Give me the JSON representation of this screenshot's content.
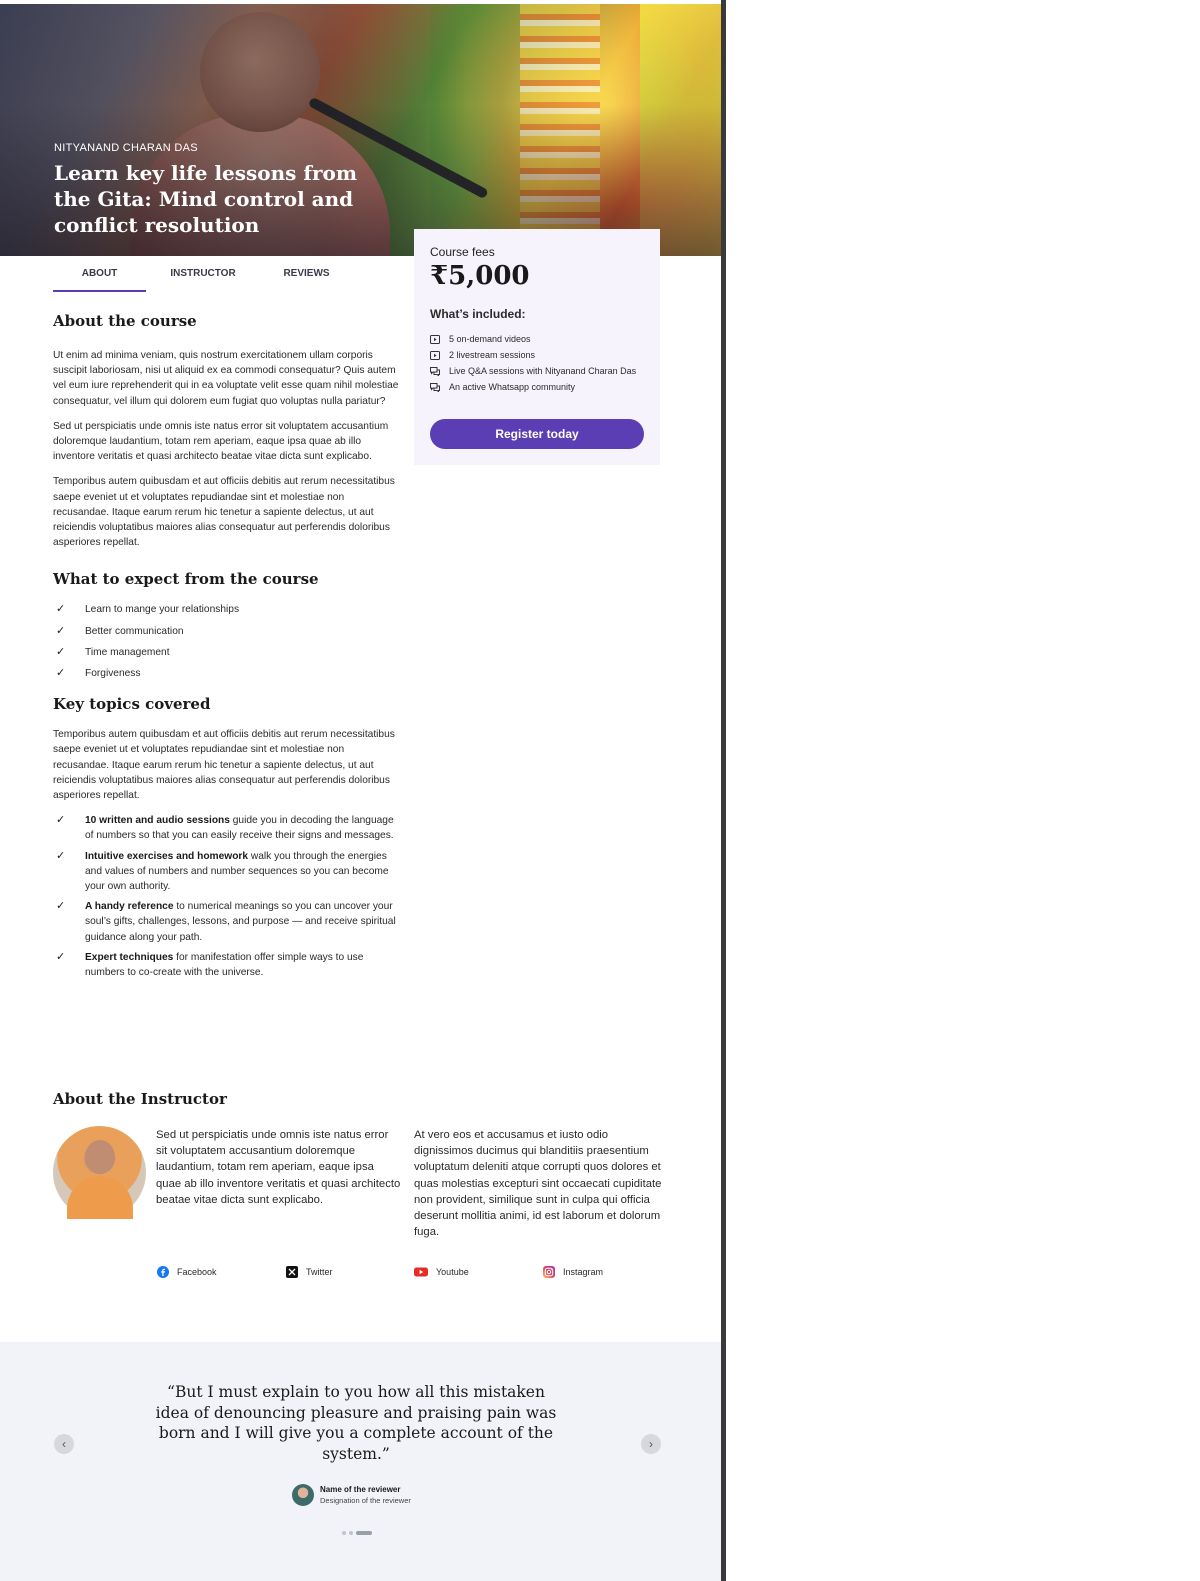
{
  "hero": {
    "eyebrow": "NITYANAND CHARAN DAS",
    "title": "Learn key life lessons from the Gita: Mind control and conflict resolution"
  },
  "tabs": [
    {
      "label": "ABOUT",
      "active": true
    },
    {
      "label": "INSTRUCTOR",
      "active": false
    },
    {
      "label": "REVIEWS",
      "active": false
    }
  ],
  "fees": {
    "label": "Course fees",
    "price": "₹5,000",
    "included_title": "What’s included:",
    "items": [
      {
        "icon": "play-video-icon",
        "text": "5 on-demand videos"
      },
      {
        "icon": "play-video-icon",
        "text": "2 livestream sessions"
      },
      {
        "icon": "chat-icon",
        "text": "Live Q&A sessions with Nityanand Charan Das"
      },
      {
        "icon": "chat-icon",
        "text": "An active Whatsapp community"
      }
    ],
    "register_label": "Register today"
  },
  "about": {
    "title": "About the course",
    "paragraphs": [
      "Ut enim ad minima veniam, quis nostrum exercitationem ullam corporis suscipit laboriosam, nisi ut aliquid ex ea commodi consequatur? Quis autem vel eum iure reprehenderit qui in ea voluptate velit esse quam nihil molestiae consequatur, vel illum qui dolorem eum fugiat quo voluptas nulla pariatur?",
      "Sed ut perspiciatis unde omnis iste natus error sit voluptatem accusantium doloremque laudantium, totam rem aperiam, eaque ipsa quae ab illo inventore veritatis et quasi architecto beatae vitae dicta sunt explicabo.",
      "Temporibus autem quibusdam et aut officiis debitis aut rerum necessitatibus saepe eveniet ut et voluptates repudiandae sint et molestiae non recusandae. Itaque earum rerum hic tenetur a sapiente delectus, ut aut reiciendis voluptatibus maiores alias consequatur aut perferendis doloribus asperiores repellat."
    ]
  },
  "expect": {
    "title": "What to expect from the course",
    "items": [
      "Learn to mange your relationships",
      "Better communication",
      "Time management",
      "Forgiveness"
    ]
  },
  "topics": {
    "title": "Key topics covered",
    "intro": "Temporibus autem quibusdam et aut officiis debitis aut rerum necessitatibus saepe eveniet ut et voluptates repudiandae sint et molestiae non recusandae. Itaque earum rerum hic tenetur a sapiente delectus, ut aut reiciendis voluptatibus maiores alias consequatur aut perferendis doloribus asperiores repellat.",
    "items": [
      {
        "bold": "10 written and audio sessions",
        "rest": " guide you in decoding the language of numbers so that you can easily receive their signs and messages."
      },
      {
        "bold": "Intuitive exercises and homework",
        "rest": " walk you through the energies and values of numbers and number sequences so you can become your own authority."
      },
      {
        "bold": "A handy reference",
        "rest": " to numerical meanings so you can uncover your soul’s gifts, challenges, lessons, and purpose — and receive spiritual guidance along your path."
      },
      {
        "bold": "Expert techniques",
        "rest": " for manifestation offer simple ways to use numbers to co-create with the universe."
      }
    ]
  },
  "instructor": {
    "title": "About the Instructor",
    "col1": "Sed ut perspiciatis unde omnis iste natus error sit voluptatem accusantium doloremque laudantium, totam rem aperiam, eaque ipsa quae ab illo inventore veritatis et quasi architecto beatae vitae dicta sunt explicabo.",
    "col2": "At vero eos et accusamus et iusto odio dignissimos ducimus qui blanditiis praesentium voluptatum deleniti atque corrupti quos dolores et quas molestias excepturi sint occaecati cupiditate non provident, similique sunt in culpa qui officia deserunt mollitia animi, id est laborum et dolorum fuga.",
    "socials": [
      {
        "label": "Facebook",
        "icon": "facebook-icon",
        "color": "#1877f2"
      },
      {
        "label": "Twitter",
        "icon": "x-twitter-icon",
        "color": "#111111"
      },
      {
        "label": "Youtube",
        "icon": "youtube-icon",
        "color": "#e52d27"
      },
      {
        "label": "Instagram",
        "icon": "instagram-icon",
        "color": "#d6249f"
      }
    ]
  },
  "testimonial": {
    "quote": "“But I must explain to you how all this mistaken idea of denouncing pleasure and praising pain was born and I will give you a complete account of the system.”",
    "reviewer_name": "Name of the reviewer",
    "reviewer_designation": "Designation of the reviewer",
    "prev_icon": "chevron-left-icon",
    "next_icon": "chevron-right-icon",
    "slide_count": 3,
    "active_slide": 3
  },
  "colors": {
    "accent": "#5b3eb3",
    "card_bg": "#f6f3fd",
    "testimonial_bg": "#f2f3f8"
  }
}
